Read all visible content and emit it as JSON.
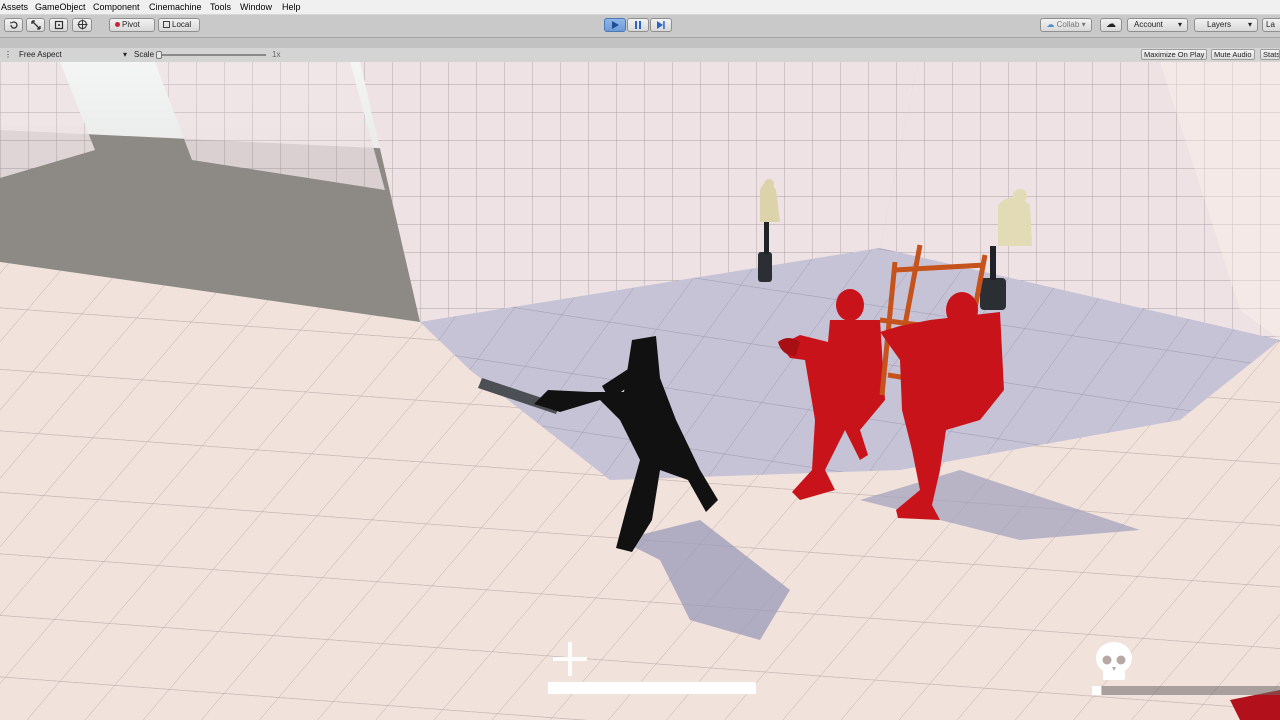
{
  "menu": {
    "items": [
      "Assets",
      "GameObject",
      "Component",
      "Cinemachine",
      "Tools",
      "Window",
      "Help"
    ]
  },
  "toolbar": {
    "pivot": "Pivot",
    "local": "Local",
    "collab": "Collab",
    "account": "Account",
    "layers": "Layers",
    "layout": "La"
  },
  "gameview": {
    "aspect": "Free Aspect",
    "scale_label": "Scale",
    "scale_value": "1x",
    "maximize": "Maximize On Play",
    "mute": "Mute Audio",
    "stats": "Stats"
  },
  "hud": {
    "player_health": 1.0,
    "enemy_bar": 0.05
  },
  "colors": {
    "enemy": "#c8131a",
    "player": "#111111",
    "play_active": "#6e9ad6"
  }
}
